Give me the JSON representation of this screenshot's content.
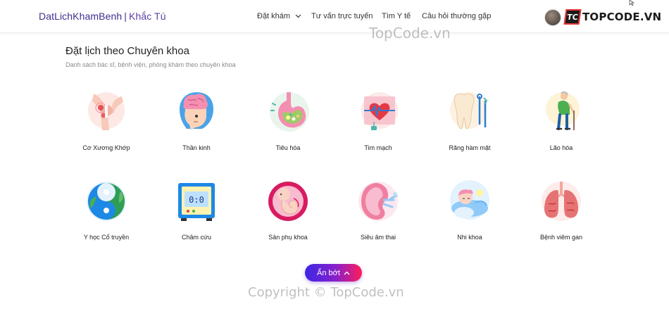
{
  "header": {
    "brand_name": "DatLichKhamBenh",
    "brand_separator": "|",
    "brand_author": "Khắc Tú",
    "nav": {
      "book": "Đặt khám",
      "consult": "Tư vấn trực tuyến",
      "find": "Tìm Y tế",
      "faq": "Câu hỏi thường gặp"
    },
    "logo_mark": "TC",
    "logo_text": "TOPCODE.VN"
  },
  "watermarks": {
    "top": "TopCode.vn",
    "bottom": "Copyright © TopCode.vn"
  },
  "section": {
    "title": "Đặt lịch theo Chuyên khoa",
    "subtitle": "Danh sách bác sĩ, bệnh viện, phòng khám theo chuyên khoa"
  },
  "specialties": [
    {
      "label": "Cơ Xương Khớp",
      "icon": "joint-icon"
    },
    {
      "label": "Thần kinh",
      "icon": "brain-icon"
    },
    {
      "label": "Tiêu hóa",
      "icon": "stomach-icon"
    },
    {
      "label": "Tim mạch",
      "icon": "heart-monitor-icon"
    },
    {
      "label": "Răng hàm mặt",
      "icon": "tooth-icon"
    },
    {
      "label": "Lão hóa",
      "icon": "elderly-icon"
    },
    {
      "label": "Y học Cổ truyền",
      "icon": "yin-yang-leaf-icon"
    },
    {
      "label": "Châm cứu",
      "icon": "acupuncture-device-icon"
    },
    {
      "label": "Sản phụ khoa",
      "icon": "fetus-icon"
    },
    {
      "label": "Siêu âm thai",
      "icon": "kidney-icon"
    },
    {
      "label": "Nhi khoa",
      "icon": "baby-icon"
    },
    {
      "label": "Bệnh viêm gan",
      "icon": "lungs-icon"
    }
  ],
  "toggle_button": {
    "label": "Ẩn bớt",
    "icon": "chevron-up-icon"
  },
  "colors": {
    "brand": "#3d2f8f",
    "button_gradient_start": "#3b27e6",
    "button_gradient_end": "#ff1e5a"
  }
}
